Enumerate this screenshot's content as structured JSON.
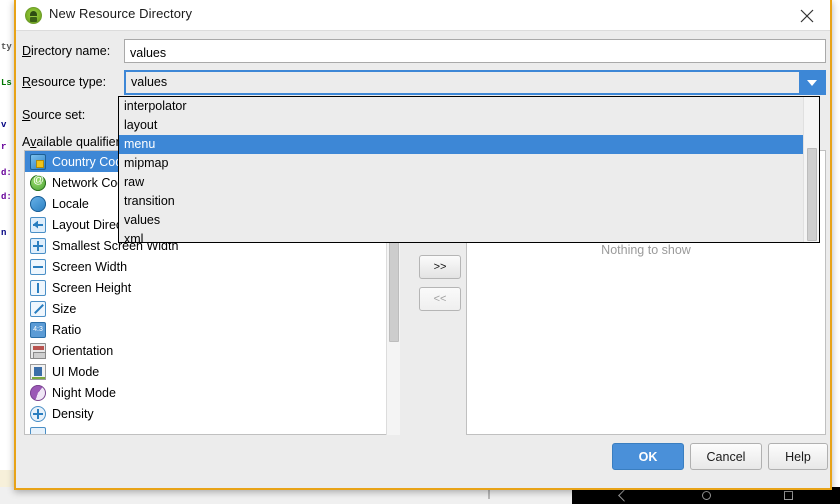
{
  "window": {
    "title": "New Resource Directory",
    "app_icon": "android-studio-icon",
    "close_icon": "close-icon"
  },
  "form": {
    "directory_name": {
      "label": "Directory name:",
      "mnemonic": "D",
      "value": "values",
      "placeholder": ""
    },
    "resource_type": {
      "label": "Resource type:",
      "mnemonic": "R",
      "value": "values",
      "dropdown_icon": "chevron-down-icon"
    },
    "source_set": {
      "label": "Source set:",
      "mnemonic": "S"
    },
    "available_qualifiers": {
      "label": "Available qualifiers",
      "mnemonic": "v"
    }
  },
  "qualifiers": {
    "items": [
      {
        "label": "Country Code",
        "icon": "flag-icon",
        "selected": true
      },
      {
        "label": "Network Code",
        "icon": "network-icon",
        "selected": false
      },
      {
        "label": "Locale",
        "icon": "globe-icon",
        "selected": false
      },
      {
        "label": "Layout Direction",
        "icon": "ltr-arrow-icon",
        "selected": false
      },
      {
        "label": "Smallest Screen Width",
        "icon": "four-arrows-icon",
        "selected": false
      },
      {
        "label": "Screen Width",
        "icon": "horizontal-arrow-icon",
        "selected": false
      },
      {
        "label": "Screen Height",
        "icon": "vertical-arrow-icon",
        "selected": false
      },
      {
        "label": "Size",
        "icon": "diagonal-arrow-icon",
        "selected": false
      },
      {
        "label": "Ratio",
        "icon": "ratio-icon",
        "selected": false
      },
      {
        "label": "Orientation",
        "icon": "orientation-icon",
        "selected": false
      },
      {
        "label": "UI Mode",
        "icon": "ui-mode-icon",
        "selected": false
      },
      {
        "label": "Night Mode",
        "icon": "night-mode-icon",
        "selected": false
      },
      {
        "label": "Density",
        "icon": "density-icon",
        "selected": false
      },
      {
        "label": "",
        "icon": "touch-screen-icon",
        "selected": false
      }
    ]
  },
  "transfer": {
    "add_label": ">>",
    "remove_label": "<<"
  },
  "chosen": {
    "empty_text": "Nothing to show"
  },
  "dropdown": {
    "open": true,
    "highlighted": "menu",
    "options": [
      "interpolator",
      "layout",
      "menu",
      "mipmap",
      "raw",
      "transition",
      "values",
      "xml"
    ]
  },
  "footer": {
    "ok_label": "OK",
    "cancel_label": "Cancel",
    "help_label": "Help"
  },
  "background": {
    "code_fragments": [
      "ty",
      "Ls",
      "v",
      "r",
      "d:",
      "d:",
      "n"
    ],
    "navbar": {
      "back_icon": "back-triangle-icon",
      "home_icon": "home-circle-icon",
      "recents_icon": "recents-square-icon"
    }
  },
  "colors": {
    "accent_blue": "#3d87d6",
    "ok_button": "#4a90d9",
    "window_border": "#e8a317",
    "panel_bg": "#ececec"
  }
}
